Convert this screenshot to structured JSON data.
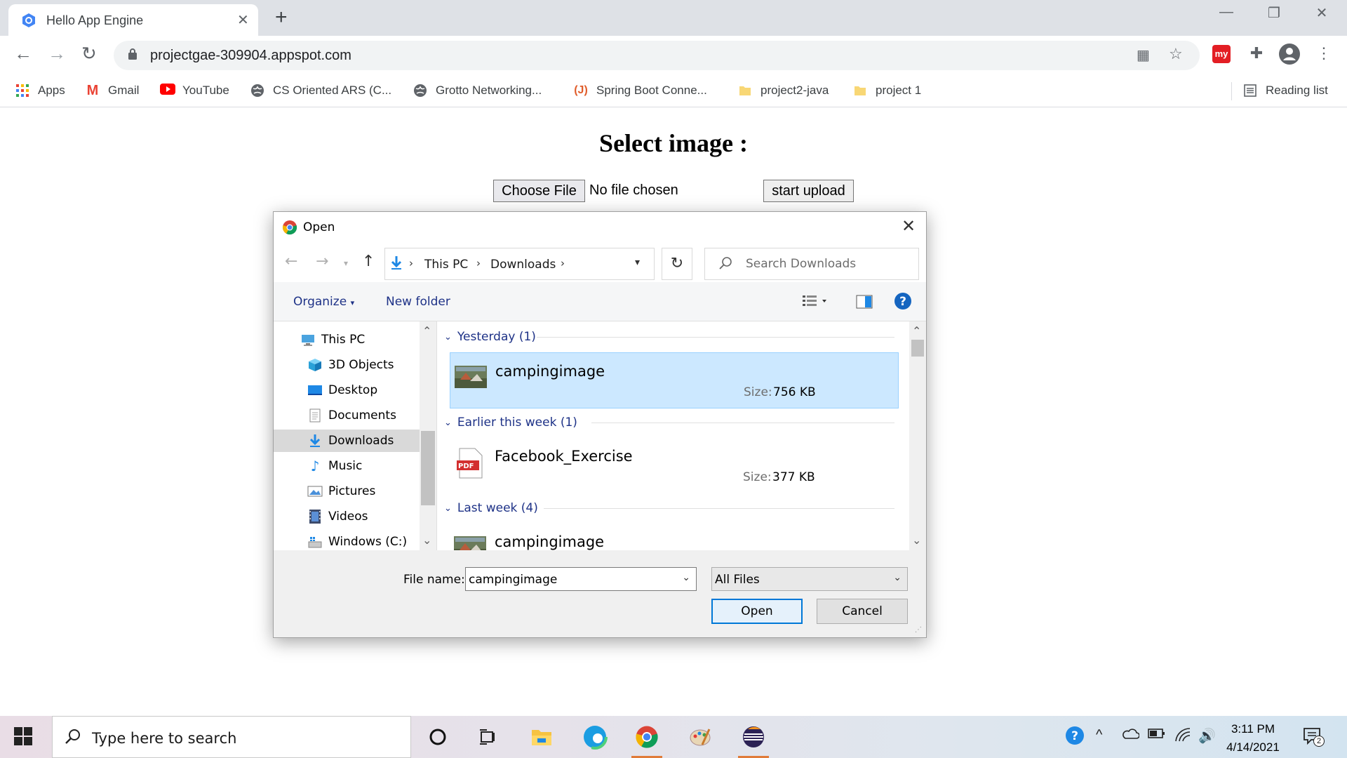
{
  "browser": {
    "tab_title": "Hello App Engine",
    "url": "projectgae-309904.appspot.com",
    "bookmarks": [
      {
        "label": "Apps",
        "icon": "apps-grid-icon"
      },
      {
        "label": "Gmail",
        "icon": "gmail-icon"
      },
      {
        "label": "YouTube",
        "icon": "youtube-icon"
      },
      {
        "label": "CS Oriented ARS (C...",
        "icon": "globe-icon"
      },
      {
        "label": "Grotto Networking...",
        "icon": "globe-icon"
      },
      {
        "label": "Spring Boot Conne...",
        "icon": "j-site-icon"
      },
      {
        "label": "project2-java",
        "icon": "folder-icon"
      },
      {
        "label": "project 1",
        "icon": "folder-icon"
      }
    ],
    "reading_list": "Reading list"
  },
  "page": {
    "heading": "Select image :",
    "choose_file": "Choose File",
    "no_file": "No file chosen",
    "start_upload": "start upload"
  },
  "dialog": {
    "title": "Open",
    "breadcrumb": [
      "This PC",
      "Downloads"
    ],
    "search_placeholder": "Search Downloads",
    "organize": "Organize",
    "new_folder": "New folder",
    "nav_items": [
      {
        "label": "This PC",
        "icon": "pc-icon"
      },
      {
        "label": "3D Objects",
        "icon": "cube-icon"
      },
      {
        "label": "Desktop",
        "icon": "desktop-icon"
      },
      {
        "label": "Documents",
        "icon": "document-icon"
      },
      {
        "label": "Downloads",
        "icon": "download-icon"
      },
      {
        "label": "Music",
        "icon": "music-icon"
      },
      {
        "label": "Pictures",
        "icon": "pictures-icon"
      },
      {
        "label": "Videos",
        "icon": "videos-icon"
      },
      {
        "label": "Windows (C:)",
        "icon": "drive-icon"
      }
    ],
    "selected_nav": "Downloads",
    "groups": [
      {
        "header": "Yesterday (1)",
        "files": [
          {
            "name": "campingimage",
            "size_label": "Size:",
            "size": "756 KB",
            "kind": "image"
          }
        ]
      },
      {
        "header": "Earlier this week (1)",
        "files": [
          {
            "name": "Facebook_Exercise",
            "size_label": "Size:",
            "size": "377 KB",
            "kind": "pdf"
          }
        ]
      },
      {
        "header": "Last week (4)",
        "files": [
          {
            "name": "campingimage",
            "kind": "image"
          }
        ]
      }
    ],
    "filename_label": "File name:",
    "filename_value": "campingimage",
    "filetype": "All Files",
    "open": "Open",
    "cancel": "Cancel",
    "pdf_badge": "PDF"
  },
  "taskbar": {
    "search_placeholder": "Type here to search",
    "time": "3:11 PM",
    "date": "4/14/2021",
    "notification_count": "2"
  },
  "colors": {
    "accent": "#0078d7",
    "selection": "#cce8ff",
    "link": "#1e3287"
  }
}
